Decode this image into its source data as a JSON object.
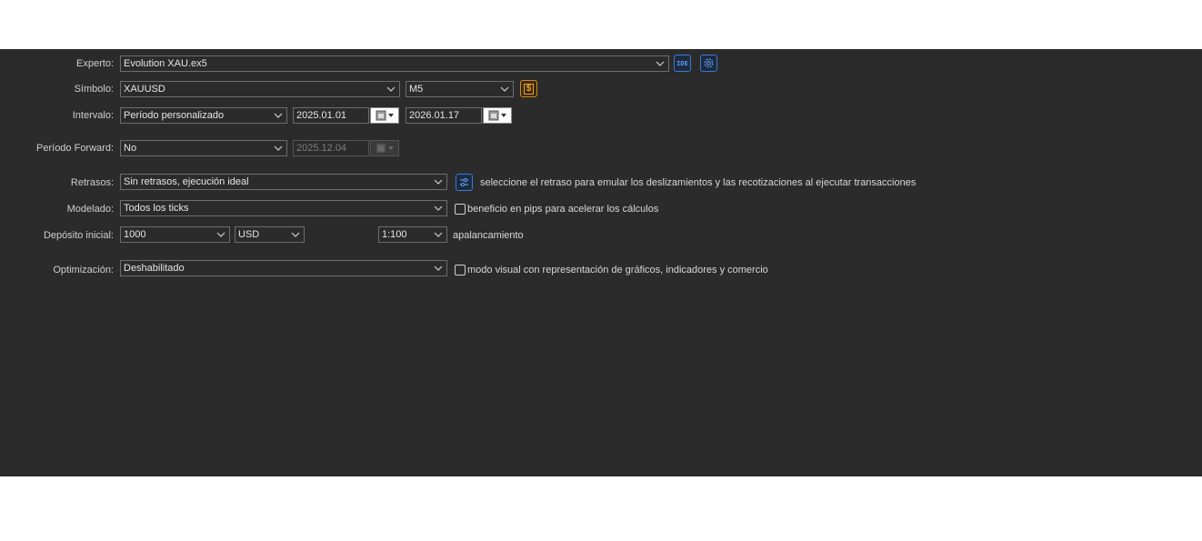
{
  "colors": {
    "panel_bg": "#2b2b2b",
    "accent_blue": "#3a78d8",
    "accent_gold": "#d08a1a"
  },
  "rows": {
    "expert": {
      "label": "Experto:",
      "value": "Evolution  XAU.ex5",
      "icons": [
        "ide-icon",
        "gear-icon"
      ]
    },
    "symbol": {
      "label": "Símbolo:",
      "value": "XAUUSD",
      "timeframe": "M5",
      "icon": "dollar-icon"
    },
    "interval": {
      "label": "Intervalo:",
      "value": "Período personalizado",
      "from": "2025.01.01",
      "to": "2026.01.17"
    },
    "forward": {
      "label": "Período Forward:",
      "value": "No",
      "date": "2025.12.04"
    },
    "delays": {
      "label": "Retrasos:",
      "value": "Sin retrasos, ejecución ideal",
      "hint": "seleccione el retraso para emular los deslizamientos y las recotizaciones al ejecutar transacciones"
    },
    "modeling": {
      "label": "Modelado:",
      "value": "Todos los ticks",
      "checkbox_label": "beneficio en pips para acelerar los cálculos",
      "checked": false
    },
    "deposit": {
      "label": "Depósito inicial:",
      "value": "1000",
      "currency": "USD",
      "leverage": "1:100",
      "leverage_label": "apalancamiento"
    },
    "optimization": {
      "label": "Optimización:",
      "value": "Deshabilitado",
      "checkbox_label": "modo visual con representación de gráficos, indicadores y comercio",
      "checked": false
    }
  }
}
